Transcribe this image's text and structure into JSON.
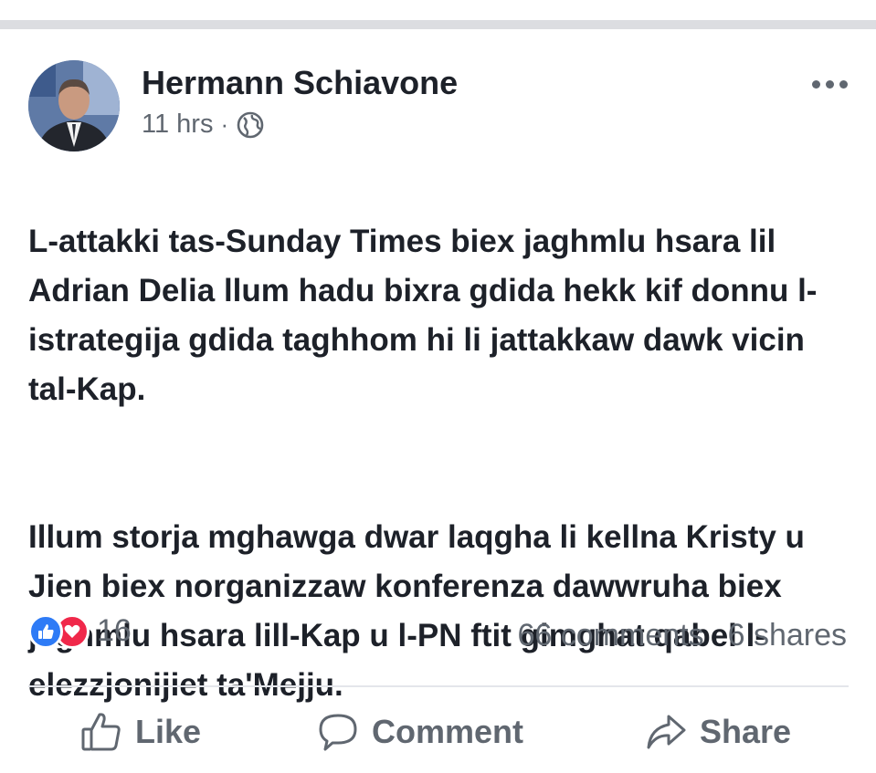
{
  "post": {
    "author": "Hermann Schiavone",
    "time": "11 hrs",
    "separator": "·",
    "audience_icon": "globe-icon",
    "paragraph_1": "L-attakki tas-Sunday Times biex jaghmlu hsara lil Adrian Delia llum hadu bixra gdida hekk kif donnu l-istrategija gdida taghhom hi li  jattakkaw dawk vicin tal-Kap.",
    "paragraph_2": "Illum storja mghawga dwar laqgha li kellna Kristy u Jien biex norganizzaw konferenza dawwruha biex jaghmlu hsara lill-Kap u l-PN ftit gimghat qabel l-elezzjonijiet ta'Mejju.",
    "reactions": {
      "icons": [
        "like-reaction-icon",
        "love-reaction-icon"
      ],
      "count": "16"
    },
    "comments": "66 comments",
    "shares": "6 shares"
  },
  "actions": {
    "like": "Like",
    "comment": "Comment",
    "share": "Share"
  },
  "colors": {
    "text": "#1d2129",
    "secondary": "#606770",
    "like_blue": "#2e7bf6",
    "love_red": "#f0284a"
  }
}
